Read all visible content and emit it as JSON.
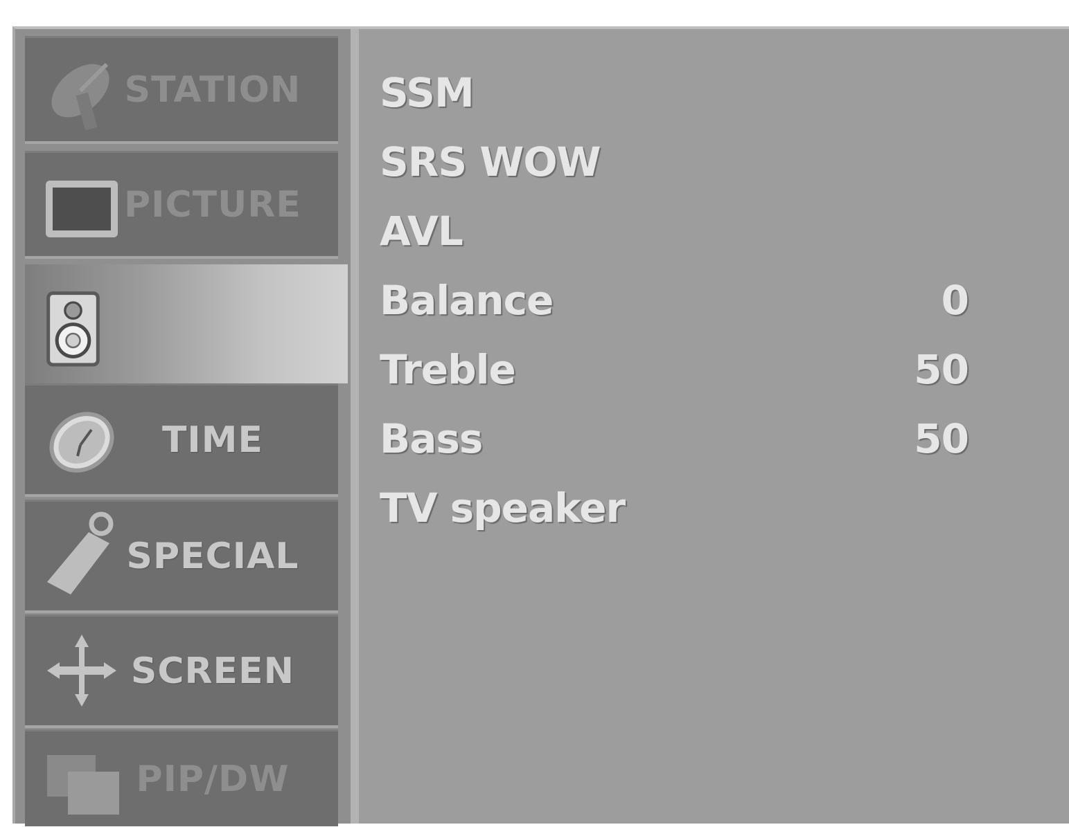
{
  "menu": {
    "tabs": [
      {
        "label": "STATION",
        "icon": "satellite-dish-icon",
        "state": "dim"
      },
      {
        "label": "PICTURE",
        "icon": "monitor-icon",
        "state": "dim"
      },
      {
        "label": "",
        "icon": "speaker-icon",
        "state": "active"
      },
      {
        "label": "TIME",
        "icon": "clock-icon",
        "state": "normal"
      },
      {
        "label": "SPECIAL",
        "icon": "tag-icon",
        "state": "normal"
      },
      {
        "label": "SCREEN",
        "icon": "move-arrows-icon",
        "state": "normal"
      },
      {
        "label": "PIP/DW",
        "icon": "pip-windows-icon",
        "state": "dim"
      }
    ]
  },
  "audio": {
    "items": [
      {
        "label": "SSM",
        "value": ""
      },
      {
        "label": "SRS WOW",
        "value": ""
      },
      {
        "label": "AVL",
        "value": ""
      },
      {
        "label": "Balance",
        "value": "0"
      },
      {
        "label": "Treble",
        "value": "50"
      },
      {
        "label": "Bass",
        "value": "50"
      },
      {
        "label": "TV speaker",
        "value": ""
      }
    ]
  },
  "colors": {
    "panel": "#9d9d9d",
    "tab": "#6e6e6e",
    "text": "#e6e6e6"
  }
}
